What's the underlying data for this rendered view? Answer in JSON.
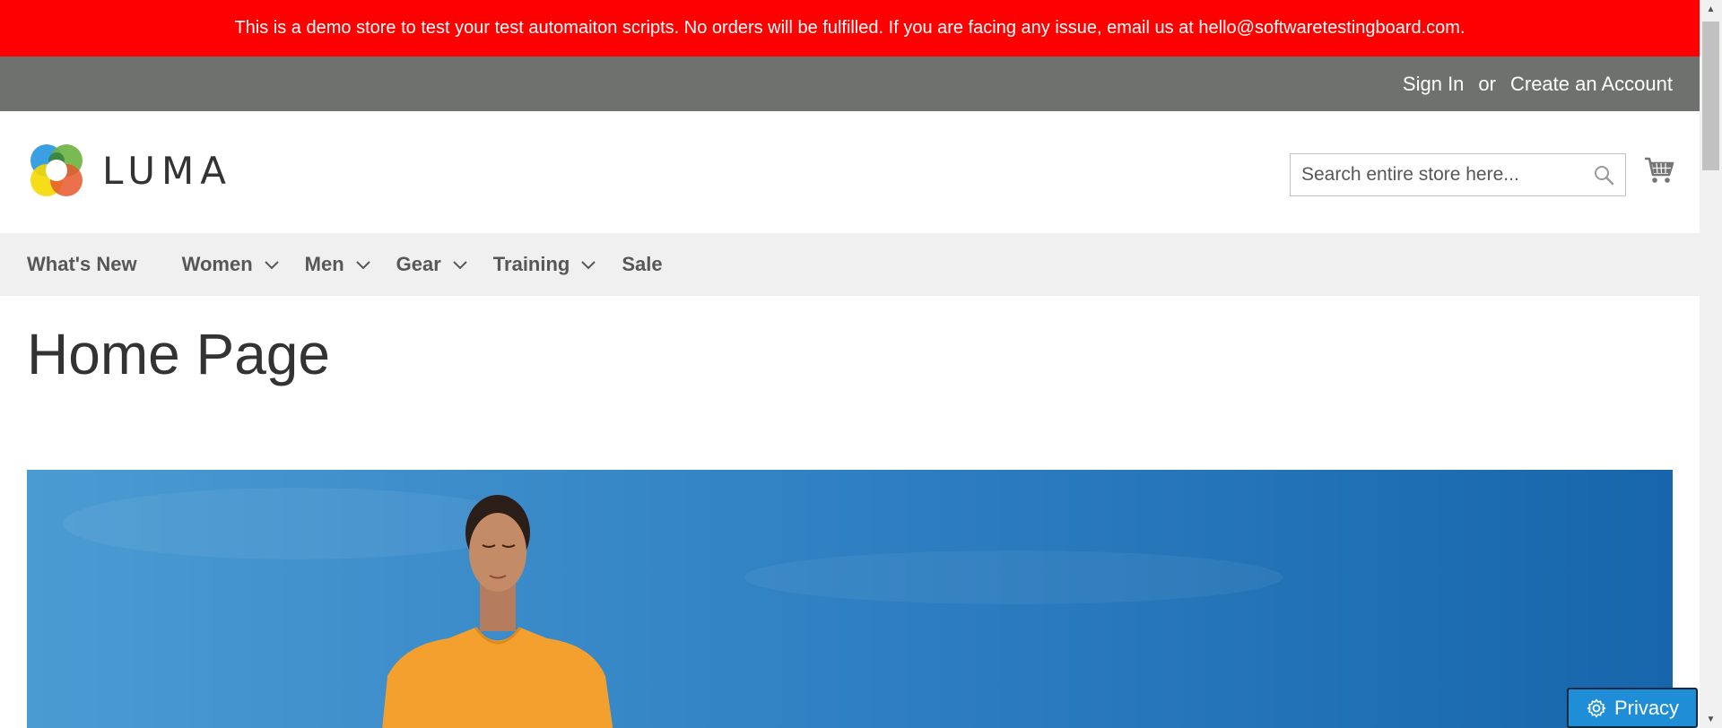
{
  "notice": {
    "text": "This is a demo store to test your test automaiton scripts. No orders will be fulfilled. If you are facing any issue, email us at hello@softwaretestingboard.com."
  },
  "header_links": {
    "sign_in": "Sign In",
    "separator": "or",
    "create_account": "Create an Account"
  },
  "logo": {
    "text": "LUMA"
  },
  "search": {
    "placeholder": "Search entire store here..."
  },
  "nav": {
    "items": [
      {
        "label": "What's New",
        "has_dropdown": false
      },
      {
        "label": "Women",
        "has_dropdown": true
      },
      {
        "label": "Men",
        "has_dropdown": true
      },
      {
        "label": "Gear",
        "has_dropdown": true
      },
      {
        "label": "Training",
        "has_dropdown": true
      },
      {
        "label": "Sale",
        "has_dropdown": false
      }
    ]
  },
  "page": {
    "title": "Home Page"
  },
  "privacy": {
    "label": "Privacy"
  },
  "colors": {
    "notice_bg": "#ff0000",
    "header_bg": "#6e716e",
    "nav_bg": "#f0f0f0",
    "privacy_bg": "#1f8ed6"
  },
  "icons": {
    "search": "search-icon",
    "cart": "cart-icon",
    "chevron": "chevron-down-icon",
    "privacy": "gear-icon"
  }
}
